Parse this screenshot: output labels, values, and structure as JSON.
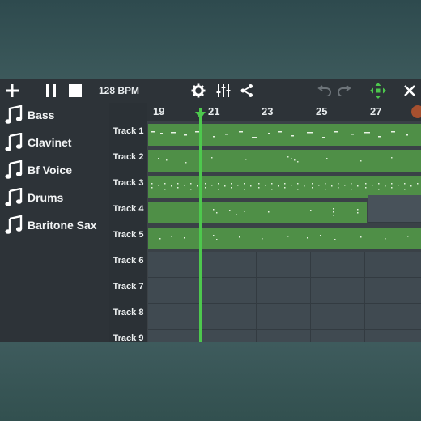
{
  "toolbar": {
    "bpm_label": "128 BPM",
    "icons": [
      "plus-icon",
      "pause-icon",
      "stop-icon",
      "gear-icon",
      "mixer-icon",
      "share-icon",
      "undo-icon",
      "redo-icon",
      "move-icon",
      "close-icon"
    ]
  },
  "instruments": [
    {
      "label": "Bass"
    },
    {
      "label": "Clavinet"
    },
    {
      "label": "Bf Voice"
    },
    {
      "label": "Drums"
    },
    {
      "label": "Baritone Sax"
    }
  ],
  "ruler": {
    "numbers": [
      "19",
      "21",
      "23",
      "25",
      "27"
    ]
  },
  "tracks": [
    {
      "label": "Track 1"
    },
    {
      "label": "Track 2"
    },
    {
      "label": "Track 3"
    },
    {
      "label": "Track 4"
    },
    {
      "label": "Track 5"
    },
    {
      "label": "Track 6"
    },
    {
      "label": "Track 7"
    },
    {
      "label": "Track 8"
    },
    {
      "label": "Track 9"
    }
  ],
  "colors": {
    "accent_green": "#4dc84d",
    "clip_green": "#4f8f47",
    "toolbar_bg": "#2d3338",
    "grid_bg": "#3a4147"
  }
}
